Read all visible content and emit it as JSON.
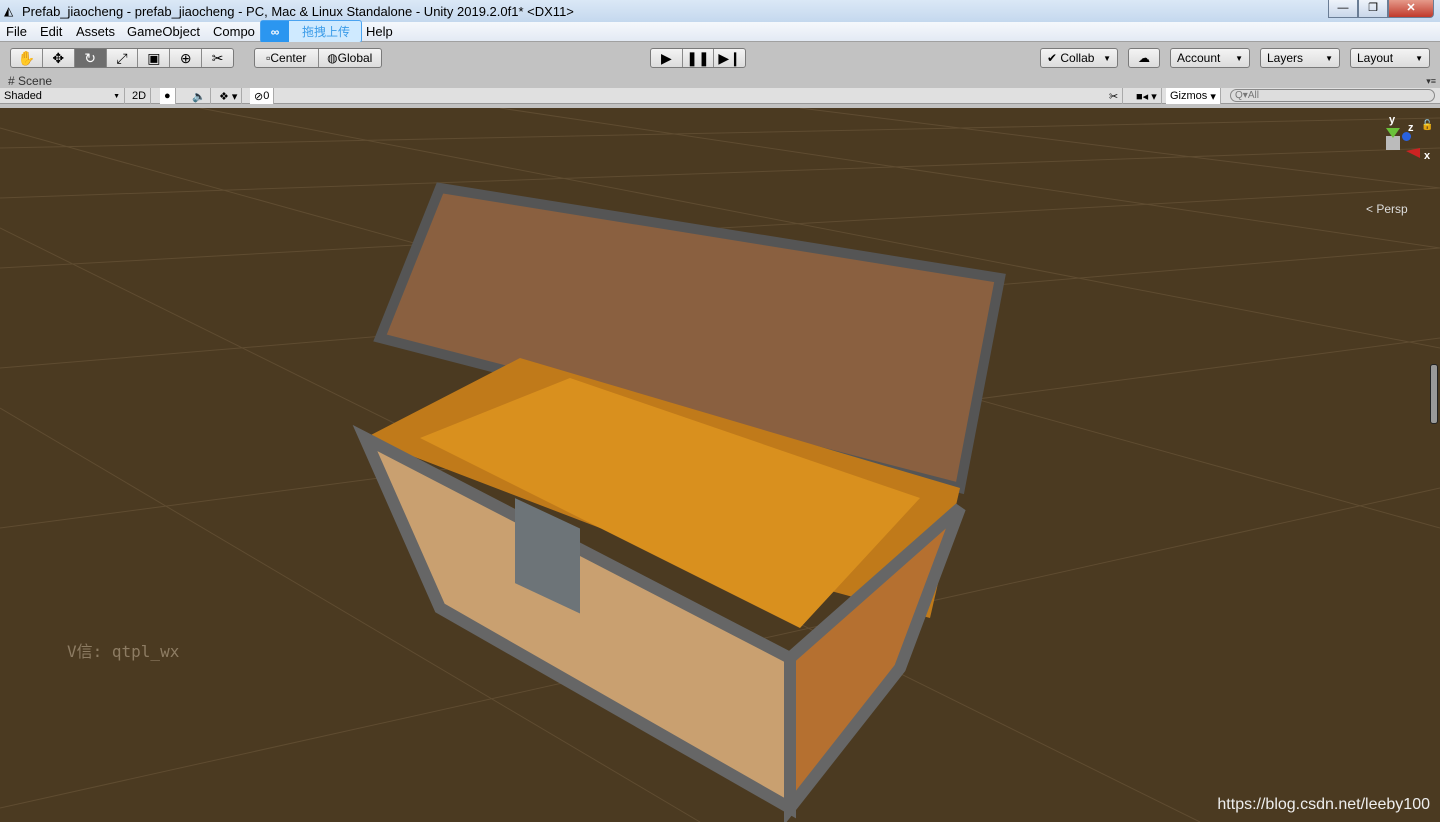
{
  "window": {
    "title": "Prefab_jiaocheng - prefab_jiaocheng - PC, Mac & Linux Standalone - Unity 2019.2.0f1* <DX11>",
    "minimize": "—",
    "restore": "❐",
    "close": "✕"
  },
  "menu": [
    "File",
    "Edit",
    "Assets",
    "GameObject",
    "Compo",
    "Help"
  ],
  "upload_popup": {
    "label": "拖拽上传"
  },
  "toolbar": {
    "tools": [
      "hand-tool",
      "move-tool",
      "rotate-tool",
      "scale-tool",
      "rect-tool",
      "transform-tool",
      "custom-tool"
    ],
    "center": "Center",
    "global": "Global",
    "collab": "Collab",
    "account": "Account",
    "layers": "Layers",
    "layout": "Layout"
  },
  "scene_tab": {
    "label": "Scene"
  },
  "scene_bar": {
    "shading": "Shaded",
    "mode_2d": "2D",
    "hidden_count": "0",
    "gizmos": "Gizmos",
    "search_placeholder": "All"
  },
  "viewport": {
    "projection": "Persp",
    "axis_y": "y",
    "axis_z": "z",
    "axis_x": "x",
    "watermark": "V信: qtpl_wx",
    "credit": "https://blog.csdn.net/leeby100"
  }
}
